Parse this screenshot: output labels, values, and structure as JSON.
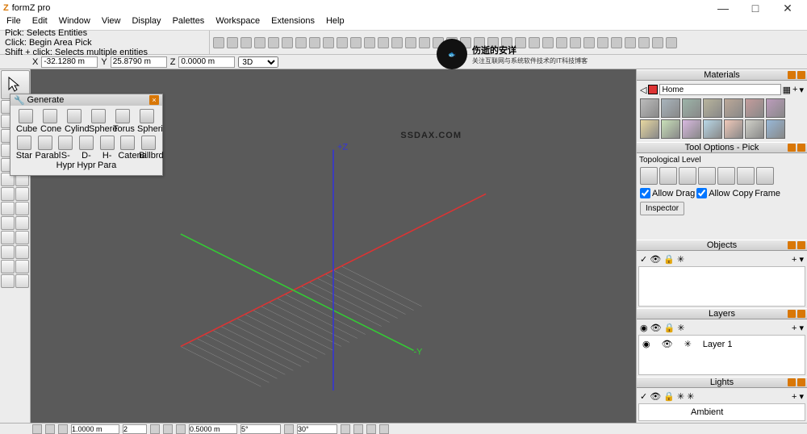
{
  "app": {
    "title": "formZ pro"
  },
  "menubar": [
    "File",
    "Edit",
    "Window",
    "View",
    "Display",
    "Palettes",
    "Workspace",
    "Extensions",
    "Help"
  ],
  "pick": {
    "header": "Pick:   Selects Entities",
    "click": "Click: Begin Area Pick",
    "shift": "Shift + click: Selects multiple entities"
  },
  "coords": {
    "x_label": "X",
    "x_value": "-32.1280 m",
    "y_label": "Y",
    "y_value": "25.8790 m",
    "z_label": "Z",
    "z_value": "0.0000 m",
    "mode": "3D"
  },
  "watermark": {
    "title": "伤逝的安详",
    "sub": "关注互联网与系统软件技术的IT科技博客",
    "side": "SSDAX.COM"
  },
  "generate": {
    "title": "Generate",
    "row1": [
      "Cube",
      "Cone",
      "Cylind",
      "Sphere",
      "Torus",
      "Spheri"
    ],
    "row2": [
      "Star",
      "Parabl",
      "S-Hypr",
      "D-Hypr",
      "H-Para",
      "Catena",
      "Billbrd"
    ]
  },
  "right": {
    "materials": {
      "title": "Materials",
      "home": "Home"
    },
    "swatch_colors": [
      "#bcbcbc",
      "#a8b4bc",
      "#9cb4a8",
      "#b8b49c",
      "#bca898",
      "#c49c9c",
      "#bc9cbc",
      "#e8d8a0",
      "#c8e0b8",
      "#d8b8e0",
      "#b8d8e8",
      "#f0c8b8",
      "#d0d0c8",
      "#98b8d8"
    ],
    "tool_options": {
      "title": "Tool Options - Pick",
      "topo": "Topological Level",
      "allow_drag": "Allow Drag",
      "allow_copy": "Allow Copy",
      "frame": "Frame",
      "inspector": "Inspector"
    },
    "objects": {
      "title": "Objects"
    },
    "layers": {
      "title": "Layers",
      "layer1": "Layer 1"
    },
    "lights": {
      "title": "Lights",
      "ambient": "Ambient"
    }
  },
  "status": {
    "val1": "1.0000 m",
    "val2": "2",
    "val3": "0.5000 m",
    "val4": "5°",
    "val5": "30°"
  }
}
